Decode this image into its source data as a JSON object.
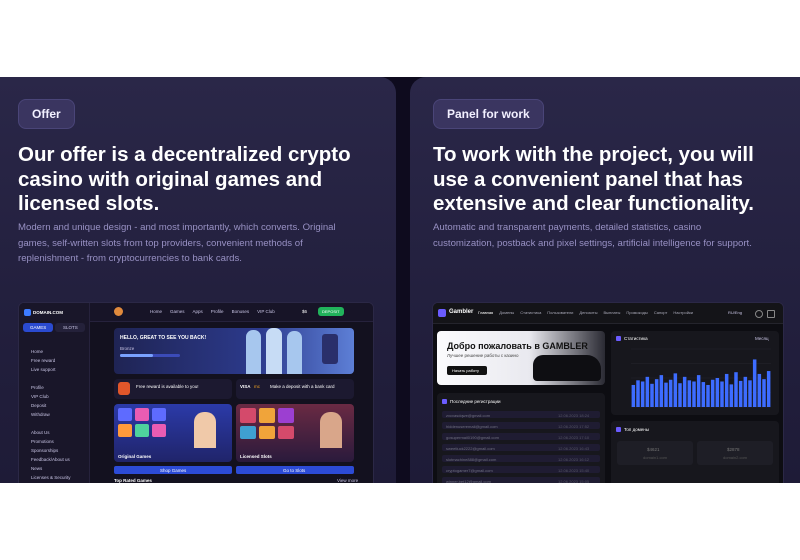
{
  "offer": {
    "badge": "Offer",
    "headline_lines": [
      "Our offer is a decentralized crypto",
      "casino with original games and",
      "licensed slots."
    ],
    "description_lines": [
      "Modern and unique design - and most importantly, which converts. Original",
      "games, self-written slots from top providers, convenient methods of",
      "replenishment - from cryptocurrencies to bank cards."
    ],
    "screenshot": {
      "logo": "DOMAIN.COM",
      "sidebar_tabs": [
        "GAMES",
        "SLOTS"
      ],
      "sidebar_items": [
        "Home",
        "Free reward",
        "Live support",
        "Profile",
        "VIP Club",
        "Deposit",
        "Withdraw",
        "About Us",
        "Promotions",
        "Sponsorships",
        "Feedback/About us",
        "News",
        "Licenses & Security"
      ],
      "nav_items": [
        "Home",
        "Games",
        "Apps",
        "Profile",
        "Bonuses",
        "VIP Club"
      ],
      "deposit_button": "DEPOSIT",
      "balance": "$6",
      "welcome": "HELLO, GREAT TO SEE YOU BACK!",
      "level": "Bronze",
      "free_reward": "Free reward is available to you!",
      "deposit_card": "Make a deposit with a bank card",
      "card_brands": [
        "VISA",
        "mc"
      ],
      "original_games_title": "Original Games",
      "licensed_slots_title": "Licensed Slots",
      "play_button": "Shop Games",
      "slots_button": "Go to Slots",
      "top_rated": "Top Rated Games",
      "view_more": "View more"
    }
  },
  "panel": {
    "badge": "Panel for work",
    "headline_lines": [
      "To work with the project, you will",
      "use a convenient panel that has",
      "extensive and clear functionality."
    ],
    "description_lines": [
      "Automatic and transparent payments, detailed statistics, casino",
      "customization, postback and pixel settings, artificial intelligence for support."
    ],
    "screenshot": {
      "logo": "Gambler",
      "nav_items": [
        "Главная",
        "Домены",
        "Статистика",
        "Пользователи",
        "Депозиты",
        "Выплаты",
        "Промокоды",
        "Сапорт",
        "Настройки"
      ],
      "lang": "RU/Eng",
      "banner_title": "Добро пожаловать в GAMBLER",
      "banner_sub": "Лучшее решение работы с казино",
      "banner_button": "Начать работу",
      "stats_title": "Статистика",
      "stats_filter": "Месяц",
      "registrations_title": "Последние регистрации",
      "registrations": [
        {
          "email": "zxcvasdqwe@gmail.com",
          "date": "12.06.2023 18:24"
        },
        {
          "email": "hiddenuseremail@gmail.com",
          "date": "12.06.2023 17:52"
        },
        {
          "email": "gosupermail0190@gmail.com",
          "date": "12.06.2023 17:10"
        },
        {
          "email": "sweetluck2222@gmail.com",
          "date": "12.06.2023 16:43"
        },
        {
          "email": "slotmachine888@gmail.com",
          "date": "12.06.2023 16:12"
        },
        {
          "email": "cryptogamer7@gmail.com",
          "date": "12.06.2023 15:40"
        },
        {
          "email": "winner.bet12@gmail.com",
          "date": "12.06.2023 15:05"
        }
      ],
      "top_domains_title": "Топ домены",
      "top_domains": [
        {
          "name": "domain1.com",
          "value": "$4621"
        },
        {
          "name": "domain2.com",
          "value": "$2878"
        }
      ]
    }
  },
  "chart_data": {
    "type": "bar",
    "title": "Статистика",
    "categories": [
      "1",
      "2",
      "3",
      "4",
      "5",
      "6",
      "7",
      "8",
      "9",
      "10",
      "11",
      "12",
      "13",
      "14",
      "15",
      "16",
      "17",
      "18",
      "19",
      "20",
      "21",
      "22",
      "23",
      "24",
      "25",
      "26",
      "27",
      "28",
      "29",
      "30"
    ],
    "values": [
      38,
      46,
      44,
      52,
      40,
      48,
      55,
      42,
      47,
      58,
      41,
      52,
      46,
      44,
      55,
      43,
      38,
      47,
      50,
      44,
      57,
      39,
      60,
      45,
      52,
      46,
      82,
      57,
      48,
      62
    ],
    "ylim": [
      0,
      100
    ],
    "grid": true,
    "colors": {
      "bar": "#3d6cff"
    }
  }
}
